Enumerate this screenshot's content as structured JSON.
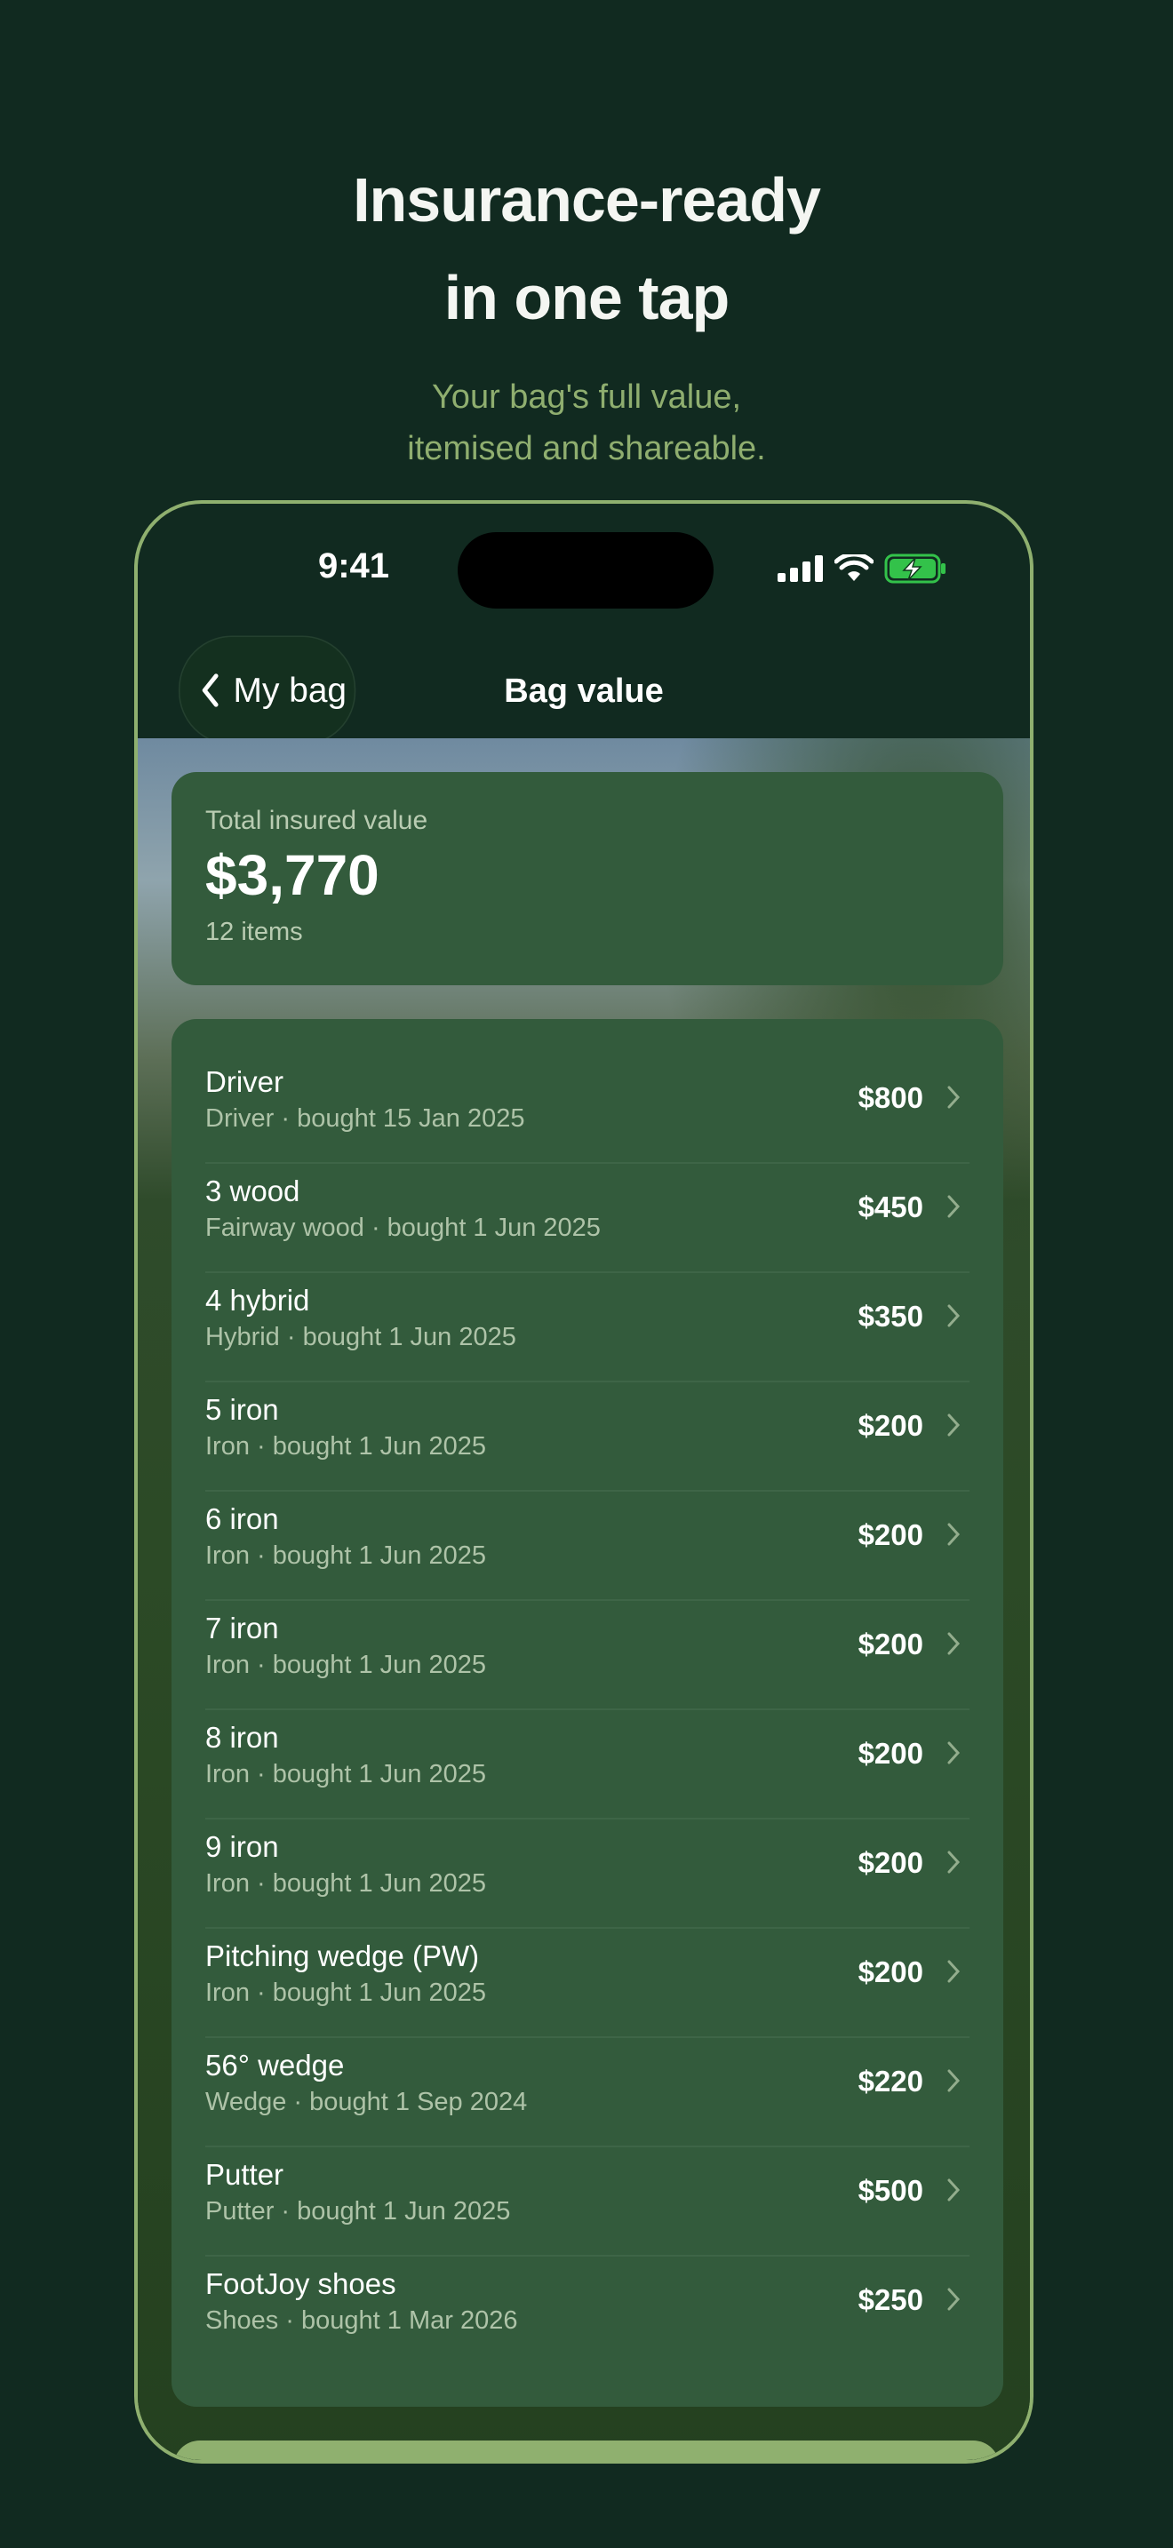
{
  "marketing": {
    "headline_line1": "Insurance-ready",
    "headline_line2": "in one tap",
    "sub_line1": "Your bag's full value,",
    "sub_line2": "itemised and shareable."
  },
  "status_bar": {
    "time": "9:41",
    "signal_icon": "cellular-signal-icon",
    "wifi_icon": "wifi-icon",
    "battery_icon": "battery-charging-icon"
  },
  "nav": {
    "back_label": "My bag",
    "title": "Bag value"
  },
  "summary": {
    "label": "Total insured value",
    "value": "$3,770",
    "count": "12 items"
  },
  "items": [
    {
      "name": "Driver",
      "detail": "Driver · bought 15 Jan 2025",
      "price": "$800"
    },
    {
      "name": "3 wood",
      "detail": "Fairway wood · bought 1 Jun 2025",
      "price": "$450"
    },
    {
      "name": "4 hybrid",
      "detail": "Hybrid · bought 1 Jun 2025",
      "price": "$350"
    },
    {
      "name": "5 iron",
      "detail": "Iron · bought 1 Jun 2025",
      "price": "$200"
    },
    {
      "name": "6 iron",
      "detail": "Iron · bought 1 Jun 2025",
      "price": "$200"
    },
    {
      "name": "7 iron",
      "detail": "Iron · bought 1 Jun 2025",
      "price": "$200"
    },
    {
      "name": "8 iron",
      "detail": "Iron · bought 1 Jun 2025",
      "price": "$200"
    },
    {
      "name": "9 iron",
      "detail": "Iron · bought 1 Jun 2025",
      "price": "$200"
    },
    {
      "name": "Pitching wedge (PW)",
      "detail": "Iron · bought 1 Jun 2025",
      "price": "$200"
    },
    {
      "name": "56° wedge",
      "detail": "Wedge · bought 1 Sep 2024",
      "price": "$220"
    },
    {
      "name": "Putter",
      "detail": "Putter · bought 1 Jun 2025",
      "price": "$500"
    },
    {
      "name": "FootJoy shoes",
      "detail": "Shoes · bought 1 Mar 2026",
      "price": "$250"
    }
  ],
  "colors": {
    "background": "#112a20",
    "card": "#335b3c",
    "accent": "#8fb06f",
    "battery": "#33c24a"
  }
}
